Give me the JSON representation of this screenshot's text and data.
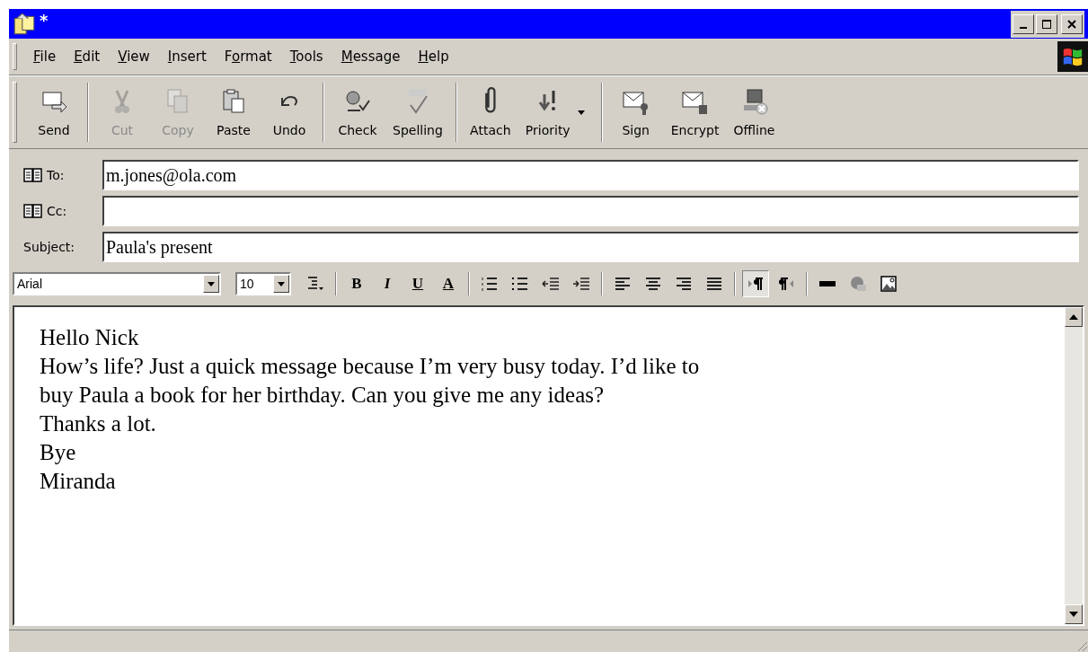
{
  "window": {
    "title": "*"
  },
  "menu": [
    {
      "label": "File"
    },
    {
      "label": "Edit"
    },
    {
      "label": "View"
    },
    {
      "label": "Insert"
    },
    {
      "label": "Format"
    },
    {
      "label": "Tools"
    },
    {
      "label": "Message"
    },
    {
      "label": "Help"
    }
  ],
  "toolbar": [
    [
      {
        "label": "Send",
        "disabled": false
      }
    ],
    [
      {
        "label": "Cut",
        "disabled": true
      },
      {
        "label": "Copy",
        "disabled": true
      },
      {
        "label": "Paste",
        "disabled": false
      },
      {
        "label": "Undo",
        "disabled": false
      }
    ],
    [
      {
        "label": "Check",
        "disabled": false
      },
      {
        "label": "Spelling",
        "disabled": false
      }
    ],
    [
      {
        "label": "Attach",
        "disabled": false
      },
      {
        "label": "Priority",
        "disabled": false,
        "dropdown": true
      }
    ],
    [
      {
        "label": "Sign",
        "disabled": false
      },
      {
        "label": "Encrypt",
        "disabled": false
      },
      {
        "label": "Offline",
        "disabled": false
      }
    ]
  ],
  "header": [
    {
      "label": "To:",
      "value": "m.jones@ola.com",
      "book": true
    },
    {
      "label": "Cc:",
      "book": true
    },
    {
      "label": "Subject:",
      "value": "Paula's present",
      "book": false
    }
  ],
  "format": {
    "font": "Arial",
    "size": "10",
    "groups": [
      [
        {
          "kind": "icon",
          "selected": false
        }
      ],
      [
        {
          "kind": "letter",
          "label": "B",
          "selected": false
        },
        {
          "kind": "letter",
          "label": "I",
          "selected": false
        },
        {
          "kind": "letter",
          "label": "U",
          "selected": false
        },
        {
          "kind": "letter",
          "label": "A",
          "selected": false
        }
      ],
      [
        {
          "kind": "icon",
          "selected": false
        },
        {
          "kind": "icon",
          "selected": false
        },
        {
          "kind": "icon",
          "selected": false
        },
        {
          "kind": "icon",
          "selected": false
        }
      ],
      [
        {
          "kind": "icon",
          "selected": false
        },
        {
          "kind": "icon",
          "selected": false
        },
        {
          "kind": "icon",
          "selected": false
        },
        {
          "kind": "icon",
          "selected": false
        }
      ],
      [
        {
          "kind": "icon",
          "selected": true
        },
        {
          "kind": "icon",
          "selected": false
        }
      ],
      [
        {
          "kind": "icon",
          "selected": false
        },
        {
          "kind": "icon",
          "selected": false
        },
        {
          "kind": "icon",
          "selected": false
        }
      ]
    ]
  },
  "body": [
    "Hello Nick",
    "How’s life? Just a quick message because I’m very busy today. I’d like to",
    "buy Paula a book for her birthday. Can you give me any ideas?",
    "Thanks a lot.",
    "Bye",
    "Miranda"
  ]
}
